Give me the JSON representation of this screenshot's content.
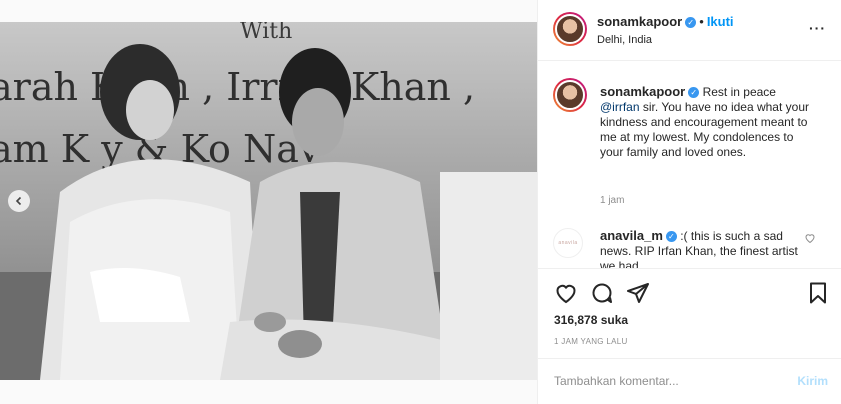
{
  "post": {
    "username": "sonamkapoor",
    "follow_label": "Ikuti",
    "location": "Delhi, India",
    "photo_text": {
      "line1": "With",
      "line2": "arah Khan ,  Irrfan Khan ,",
      "line3": "am K  y &  Ko  Nav"
    }
  },
  "caption": {
    "username": "sonamkapoor",
    "text_before": " Rest in peace ",
    "mention": "@irrfan",
    "text_after": " sir. You have no idea what your kindness and encouragement meant to me at my lowest. My condolences to your family and loved ones.",
    "time": "1 jam"
  },
  "comment2": {
    "username": "anavila_m",
    "text": " :( this is such a sad news. RIP Irfan Khan, the finest artist we had.",
    "avatar_text": "anavila"
  },
  "stats": {
    "likes": "316,878 suka",
    "time_ago": "1 JAM YANG LALU"
  },
  "add_comment": {
    "placeholder": "Tambahkan komentar...",
    "post_label": "Kirim"
  },
  "icons": [
    "heart-icon",
    "comment-icon",
    "share-icon",
    "bookmark-icon",
    "more-icon",
    "verified-icon",
    "chevron-left-icon"
  ],
  "colors": {
    "accent": "#0095f6",
    "verified": "#3897f0",
    "mention": "#00376b"
  }
}
